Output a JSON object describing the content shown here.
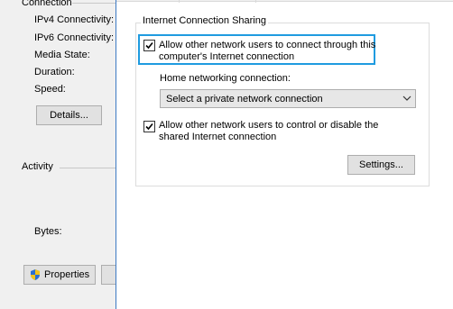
{
  "status_window": {
    "connection_group": "Connection",
    "fields": [
      {
        "label": "IPv4 Connectivity:"
      },
      {
        "label": "IPv6 Connectivity:"
      },
      {
        "label": "Media State:"
      },
      {
        "label": "Duration:"
      },
      {
        "label": "Speed:"
      }
    ],
    "details_button": "Details...",
    "activity_group": "Activity",
    "bytes_label": "Bytes:",
    "properties_button": "Properties",
    "properties_icon": "shield-icon"
  },
  "sharing_window": {
    "group_title": "Internet Connection Sharing",
    "allow_connect": {
      "checked": true,
      "line1": "Allow other network users to connect through this",
      "line2": "computer's Internet connection"
    },
    "home_networking_label": "Home networking connection:",
    "home_networking_select": "Select a private network connection",
    "allow_control": {
      "checked": true,
      "line1": "Allow other network users to control or disable the",
      "line2": "shared Internet connection"
    },
    "settings_button": "Settings...",
    "colors": {
      "focus": "#1f9be0",
      "window_border": "#3d7ac4"
    }
  }
}
